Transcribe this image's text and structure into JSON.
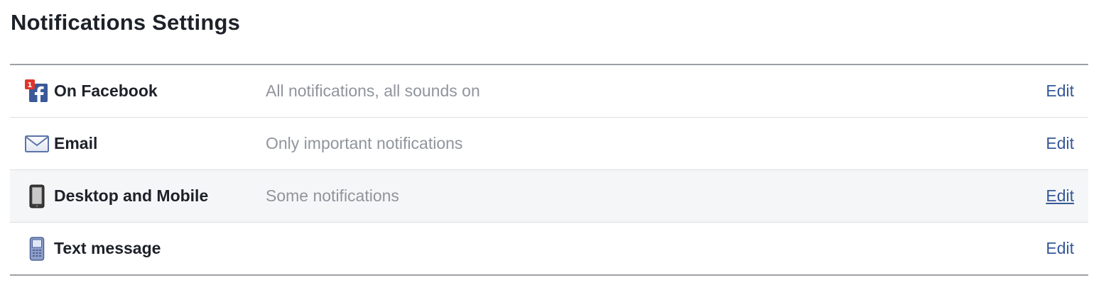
{
  "page": {
    "title": "Notifications Settings"
  },
  "colors": {
    "title": "#1d2129",
    "label": "#1d2129",
    "value": "#90949c",
    "link": "#365899",
    "hover_row_bg": "#f5f6f7",
    "border": "#9da0a5"
  },
  "rows": [
    {
      "icon": "facebook-notification-icon",
      "badge": "1",
      "label": "On Facebook",
      "value": "All notifications, all sounds on",
      "action": "Edit"
    },
    {
      "icon": "envelope-icon",
      "label": "Email",
      "value": "Only important notifications",
      "action": "Edit"
    },
    {
      "icon": "mobile-phone-icon",
      "label": "Desktop and Mobile",
      "value": "Some notifications",
      "action": "Edit",
      "hovered": true
    },
    {
      "icon": "text-message-phone-icon",
      "label": "Text message",
      "value": "",
      "action": "Edit"
    }
  ]
}
